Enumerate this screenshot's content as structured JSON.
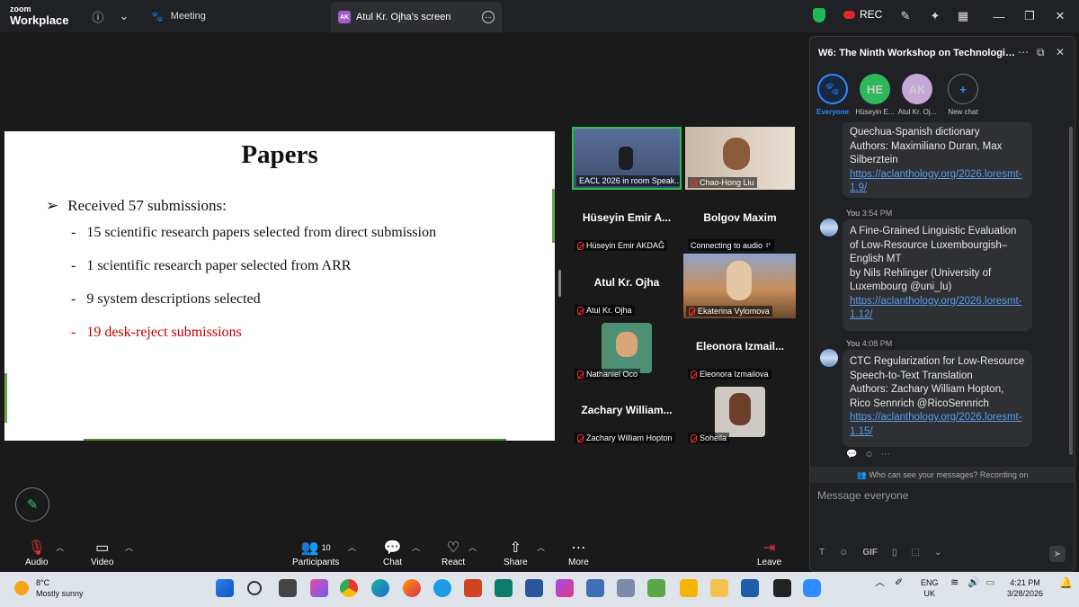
{
  "topbar": {
    "logo_line1": "zoom",
    "logo_line2": "Workplace",
    "meeting_tab": "Meeting",
    "screen_badge": "AK",
    "screen_tab": "Atul Kr. Ojha's screen",
    "rec_label": "REC"
  },
  "slide": {
    "title": "Papers",
    "bullet_marker": "➢",
    "main_bullet": "Received 57 submissions:",
    "sub_marker": "-",
    "sub_items": [
      "15 scientific research papers selected from direct submission",
      "1 scientific research paper selected from ARR",
      "9 system descriptions selected",
      "19 desk-reject submissions"
    ]
  },
  "gallery": {
    "tiles": [
      {
        "label": "EACL 2026 in room Speak..."
      },
      {
        "label": "Chao-Hong Liu"
      },
      {
        "big": "Hüseyin Emir A...",
        "label": "Hüseyin Emir AKDAĞ"
      },
      {
        "big": "Bolgov Maxim",
        "label": "Connecting to audio"
      },
      {
        "big": "Atul Kr. Ojha",
        "label": "Atul Kr. Ojha"
      },
      {
        "label": "Ekaterina Vylomova"
      },
      {
        "label": "Nathaniel Oco"
      },
      {
        "big": "Eleonora Izmail...",
        "label": "Eleonora Izmailova"
      },
      {
        "big": "Zachary William...",
        "label": "Zachary William Hopton"
      },
      {
        "label": "Soheila"
      }
    ]
  },
  "chat": {
    "title": "W6: The Ninth Workshop on Technologies f...",
    "recipients": [
      {
        "initials": "",
        "label": "Everyone"
      },
      {
        "initials": "HE",
        "label": "Hüseyin E..."
      },
      {
        "initials": "AK",
        "label": "Atul Kr. Oj..."
      },
      {
        "initials": "+",
        "label": "New chat"
      }
    ],
    "messages": [
      {
        "sender": "",
        "time": "",
        "text": "Quechua-Spanish dictionary\nAuthors: Maximiliano Duran, Max Silberztein",
        "link": "https://aclanthology.org/2026.loresmt-1.9/"
      },
      {
        "sender": "You",
        "time": "3:54 PM",
        "text": "A Fine-Grained Linguistic Evaluation of Low-Resource Luxembourgish–English MT\nby Nils Rehlinger  (University of Luxembourg @uni_lu)",
        "link": "https://aclanthology.org/2026.loresmt-1.12/"
      },
      {
        "sender": "You",
        "time": "4:08 PM",
        "text": "CTC Regularization for Low-Resource Speech-to-Text Translation\nAuthors: Zachary William Hopton, Rico Sennrich @RicoSennrich",
        "link": "https://aclanthology.org/2026.loresmt-1.15/"
      }
    ],
    "privacy": "Who can see your messages? Recording on",
    "input_placeholder": "Message everyone",
    "gif_label": "GIF"
  },
  "toolbar": {
    "audio": "Audio",
    "video": "Video",
    "participants": "Participants",
    "participants_count": "10",
    "chat": "Chat",
    "react": "React",
    "share": "Share",
    "more": "More",
    "leave": "Leave"
  },
  "taskbar": {
    "temp": "8°C",
    "weather": "Mostly sunny",
    "lang1": "ENG",
    "lang2": "UK",
    "time": "4:21 PM",
    "date": "3/28/2026"
  }
}
